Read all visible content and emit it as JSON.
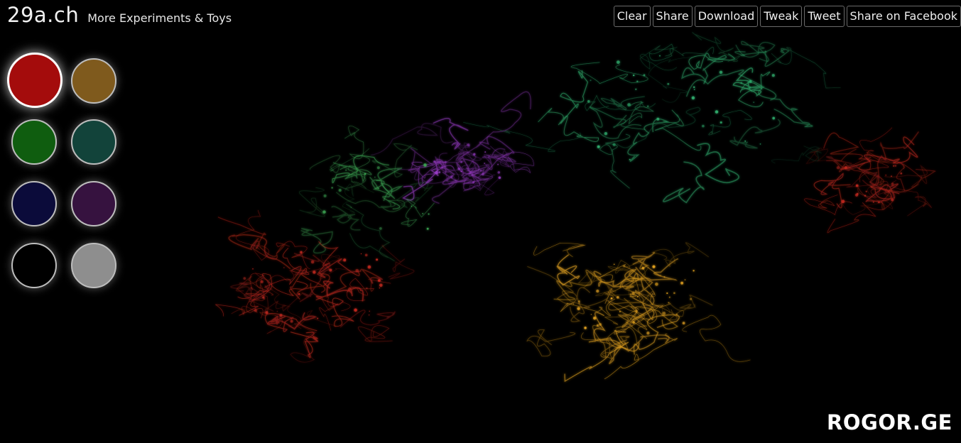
{
  "brand": {
    "title": "29a.ch",
    "link": "More Experiments & Toys"
  },
  "toolbar": {
    "buttons": [
      "Clear",
      "Share",
      "Download",
      "Tweak",
      "Tweet",
      "Share on Facebook"
    ]
  },
  "palette": {
    "selected_index": 0,
    "swatches": [
      {
        "name": "red",
        "color": "#a40c0c"
      },
      {
        "name": "gold",
        "color": "#7f5a1d"
      },
      {
        "name": "green",
        "color": "#0f5d0f"
      },
      {
        "name": "teal",
        "color": "#12433a"
      },
      {
        "name": "navy",
        "color": "#0b0b3a"
      },
      {
        "name": "purple",
        "color": "#36123f"
      },
      {
        "name": "black",
        "color": "#000000"
      },
      {
        "name": "gray",
        "color": "#8e8e8e"
      }
    ]
  },
  "canvas": {
    "trail_colors": [
      "#c0281e",
      "#e0a020",
      "#2ea86a",
      "#9a3cc8",
      "#3aa050"
    ]
  },
  "footer": {
    "wordmark": "ROGOR.GE"
  }
}
